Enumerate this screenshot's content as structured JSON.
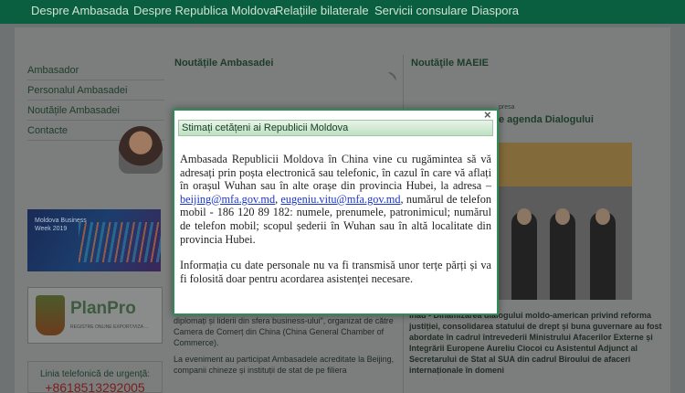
{
  "nav": {
    "items": [
      "Despre Ambasada",
      "Despre Republica Moldova",
      "Relațiile bilaterale",
      "Servicii consulare",
      "Diaspora"
    ]
  },
  "sidebar": {
    "items": [
      "Ambasador",
      "Personalul Ambasadei",
      "Noutățile Ambasadei",
      "Contacte"
    ]
  },
  "banners": {
    "business_week": "Moldova Business Week 2019",
    "planpro": "PlanPro",
    "planpro_sub": "REGISTRE ONLINE EXPORT/VIZA ..."
  },
  "hotline": {
    "label": "Linia telefonică de urgență:",
    "number": "+8618513292005"
  },
  "columns": {
    "embassy_news": "Noutățile Ambasadei",
    "maeie_news": "Noutăţile MAEIE"
  },
  "mid_text": {
    "p1": "diplomați și liderii din sfera business-ului\", organizat de către Camera de Comerț din China (China General Chamber of Commerce).",
    "p2": "La eveniment au participat Ambasadele acreditate la Beijing, companii chineze și instituții de stat de pe filiera"
  },
  "right": {
    "subtitle": "presa",
    "title": "e agenda Dialogului",
    "text": "inău - Dinamizarea dialogului moldo-american privind reforma justiției, consolidarea statului de drept și buna guvernare au fost abordate în cadrul întrevederii Ministrului Afacerilor Externe și Integrării Europene Aureliu Ciocoi cu Asistentul Adjunct al Secretarului de Stat al SUA din cadrul Biroului de afaceri internaționale în domeni"
  },
  "modal": {
    "title": "Stimați cetățeni ai Republicii Moldova",
    "close": "×",
    "p1_a": "Ambasada Republicii Moldova în China vine cu rugămintea să vă adresați prin poșta electronică sau telefonic, în cazul în care vă aflați în orașul Wuhan sau în alte orașe din provincia Hubei, la adresa –",
    "email1": "beijing@mfa.gov.md",
    "sep": ",",
    "email2": "eugeniu.vitu@mfa.gov.md",
    "p1_b": ", numărul de telefon mobil - 186 120 89 182: numele, prenumele, patronimicul; numărul de telefon mobil; scopul șederii în Wuhan sau în altă localitate din provincia Hubei.",
    "p2": "Informația cu date personale nu va fi transmisă unor terțe părți și va fi folosită doar pentru acordarea asistenței necesare."
  }
}
